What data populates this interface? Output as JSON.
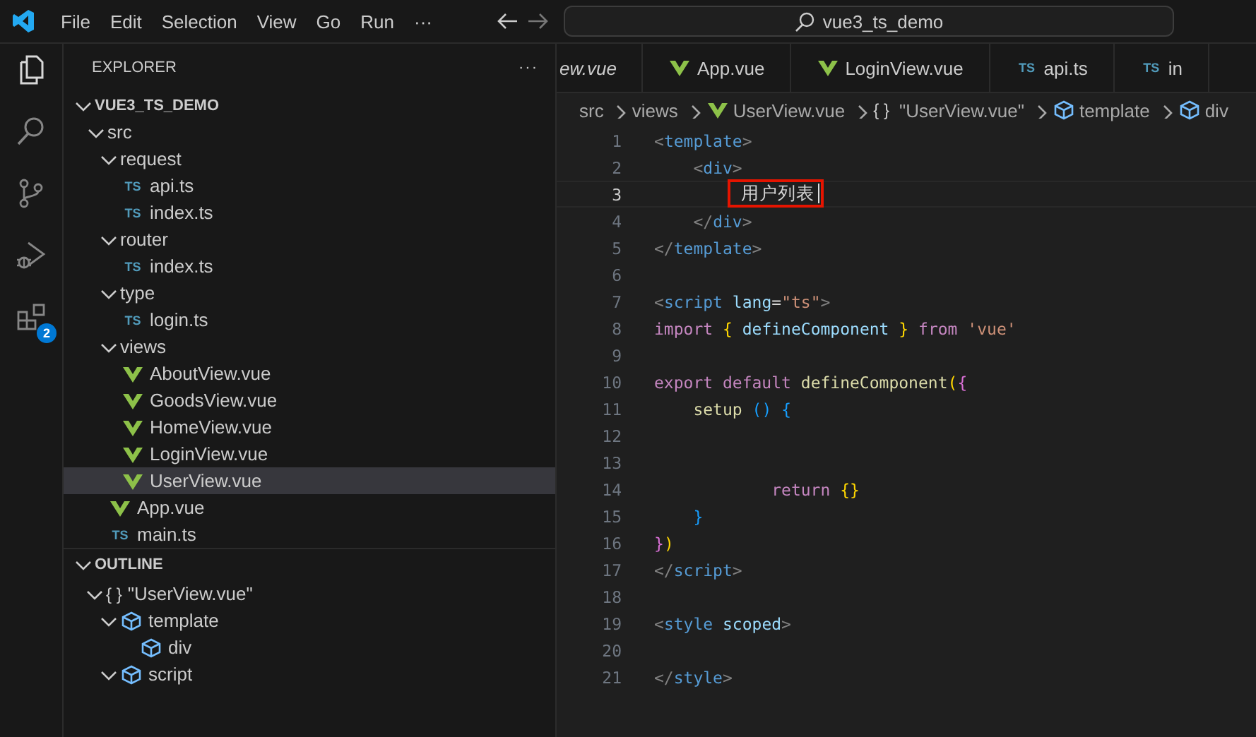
{
  "menu": [
    "File",
    "Edit",
    "Selection",
    "View",
    "Go",
    "Run",
    "···"
  ],
  "command_center": "vue3_ts_demo",
  "activity_bar": [
    {
      "kind": "files",
      "selected": true
    },
    {
      "kind": "search",
      "selected": false
    },
    {
      "kind": "source-control",
      "selected": false
    },
    {
      "kind": "run-debug",
      "selected": false
    },
    {
      "kind": "extensions",
      "selected": false,
      "badge": "2"
    }
  ],
  "explorer": {
    "title": "EXPLORER",
    "more": "···",
    "tree": [
      {
        "label": "VUE3_TS_DEMO",
        "kind": "root",
        "expanded": true,
        "selected": false,
        "children": [
          {
            "label": "src",
            "expanded": true,
            "selected": false,
            "children": [
              {
                "label": "request",
                "expanded": true,
                "selected": false,
                "children": [
                  {
                    "label": "api.ts",
                    "kind": "ts",
                    "icon_text": "TS",
                    "selected": false
                  },
                  {
                    "label": "index.ts",
                    "kind": "ts",
                    "icon_text": "TS",
                    "selected": false
                  }
                ]
              },
              {
                "label": "router",
                "expanded": true,
                "selected": false,
                "children": [
                  {
                    "label": "index.ts",
                    "kind": "ts",
                    "icon_text": "TS",
                    "selected": false
                  }
                ]
              },
              {
                "label": "type",
                "expanded": true,
                "selected": false,
                "children": [
                  {
                    "label": "login.ts",
                    "kind": "ts",
                    "icon_text": "TS",
                    "selected": false
                  }
                ]
              },
              {
                "label": "views",
                "expanded": true,
                "selected": false,
                "children": [
                  {
                    "label": "AboutView.vue",
                    "kind": "vue",
                    "selected": false
                  },
                  {
                    "label": "GoodsView.vue",
                    "kind": "vue",
                    "selected": false
                  },
                  {
                    "label": "HomeView.vue",
                    "kind": "vue",
                    "selected": false
                  },
                  {
                    "label": "LoginView.vue",
                    "kind": "vue",
                    "selected": false
                  },
                  {
                    "label": "UserView.vue",
                    "kind": "vue",
                    "selected": true
                  }
                ]
              },
              {
                "label": "App.vue",
                "kind": "vue",
                "selected": false
              },
              {
                "label": "main.ts",
                "kind": "ts",
                "icon_text": "TS",
                "selected": false
              }
            ]
          }
        ]
      }
    ]
  },
  "outline": {
    "title": "OUTLINE",
    "expanded": true,
    "tree": [
      {
        "label": "\"UserView.vue\"",
        "kind": "module",
        "icon_text": "{ }",
        "expanded": true,
        "children": [
          {
            "label": "template",
            "kind": "element",
            "expanded": true,
            "children": [
              {
                "label": "div",
                "kind": "element"
              }
            ]
          },
          {
            "label": "script",
            "kind": "element",
            "expanded": true
          }
        ]
      }
    ]
  },
  "tabs": [
    {
      "label": "ew.vue",
      "preview": true,
      "selected": false
    },
    {
      "label": "App.vue",
      "kind": "vue",
      "preview": false,
      "selected": false
    },
    {
      "label": "LoginView.vue",
      "kind": "vue",
      "preview": false,
      "selected": false
    },
    {
      "label": "api.ts",
      "kind": "ts",
      "icon_text": "TS",
      "preview": false,
      "selected": false
    },
    {
      "label": "in",
      "kind": "ts",
      "icon_text": "TS",
      "preview": false,
      "selected": false
    }
  ],
  "breadcrumbs": [
    {
      "label": "src"
    },
    {
      "label": "views"
    },
    {
      "label": "UserView.vue",
      "kind": "vue"
    },
    {
      "label": "\"UserView.vue\"",
      "kind": "module",
      "icon_text": "{ }"
    },
    {
      "label": "template",
      "kind": "element"
    },
    {
      "label": "div",
      "kind": "element"
    }
  ],
  "code": [
    {
      "number": "1",
      "current": false,
      "tokens": [
        {
          "kind": "p",
          "text": "<"
        },
        {
          "kind": "tag",
          "text": "template"
        },
        {
          "kind": "p",
          "text": ">"
        }
      ]
    },
    {
      "number": "2",
      "current": false,
      "tokens": [
        {
          "kind": "p",
          "text": "    <"
        },
        {
          "kind": "tag",
          "text": "div"
        },
        {
          "kind": "p",
          "text": ">"
        }
      ]
    },
    {
      "number": "3",
      "current": true,
      "tokens": [
        {
          "kind": "boxed",
          "text": "        用户列表"
        }
      ]
    },
    {
      "number": "4",
      "current": false,
      "tokens": [
        {
          "kind": "p",
          "text": "    </"
        },
        {
          "kind": "tag",
          "text": "div"
        },
        {
          "kind": "p",
          "text": ">"
        }
      ]
    },
    {
      "number": "5",
      "current": false,
      "tokens": [
        {
          "kind": "p",
          "text": "</"
        },
        {
          "kind": "tag",
          "text": "template"
        },
        {
          "kind": "p",
          "text": ">"
        }
      ]
    },
    {
      "number": "6",
      "current": false
    },
    {
      "number": "7",
      "current": false,
      "tokens": [
        {
          "kind": "p",
          "text": "<"
        },
        {
          "kind": "tag",
          "text": "script"
        },
        {
          "kind": "attr",
          "text": " lang"
        },
        {
          "kind": "t",
          "text": "="
        },
        {
          "kind": "str",
          "text": "\"ts\""
        },
        {
          "kind": "p",
          "text": ">"
        }
      ]
    },
    {
      "number": "8",
      "current": false,
      "tokens": [
        {
          "kind": "kw",
          "text": "import"
        },
        {
          "kind": "b1",
          "text": " {"
        },
        {
          "kind": "var",
          "text": " defineComponent"
        },
        {
          "kind": "b1",
          "text": " }"
        },
        {
          "kind": "kw",
          "text": " from"
        },
        {
          "kind": "str",
          "text": " 'vue'"
        }
      ]
    },
    {
      "number": "9",
      "current": false
    },
    {
      "number": "10",
      "current": false,
      "tokens": [
        {
          "kind": "kw",
          "text": "export"
        },
        {
          "kind": "kw",
          "text": " default"
        },
        {
          "kind": "fn",
          "text": " defineComponent"
        },
        {
          "kind": "b1",
          "text": "("
        },
        {
          "kind": "b2",
          "text": "{"
        }
      ]
    },
    {
      "number": "11",
      "current": false,
      "tokens": [
        {
          "kind": "fn",
          "text": "    setup"
        },
        {
          "kind": "b3",
          "text": " ()"
        },
        {
          "kind": "b3",
          "text": " {"
        }
      ]
    },
    {
      "number": "12",
      "current": false
    },
    {
      "number": "13",
      "current": false
    },
    {
      "number": "14",
      "current": false,
      "tokens": [
        {
          "kind": "kw",
          "text": "            return"
        },
        {
          "kind": "b1",
          "text": " {}"
        }
      ]
    },
    {
      "number": "15",
      "current": false,
      "tokens": [
        {
          "kind": "b3",
          "text": "    }"
        }
      ]
    },
    {
      "number": "16",
      "current": false,
      "tokens": [
        {
          "kind": "b2",
          "text": "}"
        },
        {
          "kind": "b1",
          "text": ")"
        }
      ]
    },
    {
      "number": "17",
      "current": false,
      "tokens": [
        {
          "kind": "p",
          "text": "</"
        },
        {
          "kind": "tag",
          "text": "script"
        },
        {
          "kind": "p",
          "text": ">"
        }
      ]
    },
    {
      "number": "18",
      "current": false
    },
    {
      "number": "19",
      "current": false,
      "tokens": [
        {
          "kind": "p",
          "text": "<"
        },
        {
          "kind": "tag",
          "text": "style"
        },
        {
          "kind": "attr",
          "text": " scoped"
        },
        {
          "kind": "p",
          "text": ">"
        }
      ]
    },
    {
      "number": "20",
      "current": false
    },
    {
      "number": "21",
      "current": false,
      "tokens": [
        {
          "kind": "p",
          "text": "</"
        },
        {
          "kind": "tag",
          "text": "style"
        },
        {
          "kind": "p",
          "text": ">"
        }
      ]
    }
  ]
}
